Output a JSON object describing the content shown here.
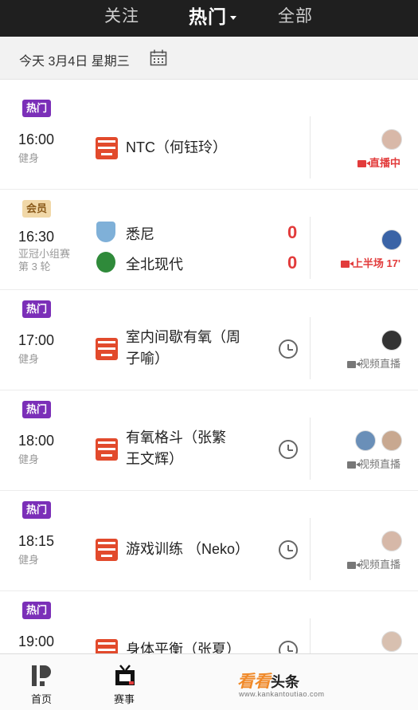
{
  "header": {
    "tabs": [
      {
        "label": "关注"
      },
      {
        "label": "热门"
      },
      {
        "label": "全部"
      }
    ]
  },
  "date_bar": {
    "text": "今天 3月4日 星期三"
  },
  "events": [
    {
      "tag": "热门",
      "time": "16:00",
      "sub": "健身",
      "title_lines": [
        "NTC（何钰玲）"
      ],
      "status": "直播中"
    },
    {
      "tag": "会员",
      "time": "16:30",
      "sub_lines": [
        "亚冠小组赛",
        "第 3 轮"
      ],
      "teams": [
        {
          "name": "悉尼",
          "score": "0"
        },
        {
          "name": "全北现代",
          "score": "0"
        }
      ],
      "status": "上半场 17'"
    },
    {
      "tag": "热门",
      "time": "17:00",
      "sub": "健身",
      "title_lines": [
        "室内间歇有氧（周",
        "子喻）"
      ],
      "status": "视频直播"
    },
    {
      "tag": "热门",
      "time": "18:00",
      "sub": "健身",
      "title_lines": [
        "有氧格斗（张繁",
        "王文辉）"
      ],
      "status": "视频直播"
    },
    {
      "tag": "热门",
      "time": "18:15",
      "sub": "健身",
      "title_lines": [
        "游戏训练 （Neko）"
      ],
      "status": "视频直播"
    },
    {
      "tag": "热门",
      "time": "19:00",
      "sub": "",
      "title_lines": [
        "身体平衡（张夏）"
      ],
      "status": ""
    }
  ],
  "bottom_nav": {
    "home": "首页",
    "matches": "赛事",
    "watermark_brand": "看看",
    "watermark_suffix": "头条",
    "watermark_url": "www.kankantoutiao.com"
  }
}
